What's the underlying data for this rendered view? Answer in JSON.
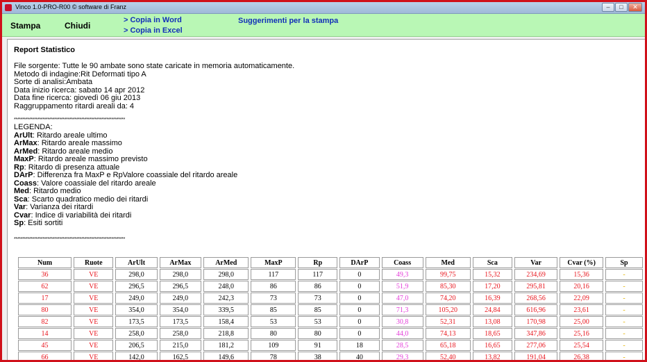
{
  "window": {
    "title": "Vinco 1.0-PRO-R00   © software di Franz"
  },
  "menu": {
    "stampa": "Stampa",
    "chiudi": "Chiudi",
    "copia_word": "> Copia in Word",
    "copia_excel": "> Copia in Excel",
    "suggerimenti": "Suggerimenti per la stampa"
  },
  "report": {
    "title": "Report Statistico",
    "info": [
      "File sorgente: Tutte le 90 ambate sono state caricate in memoria automaticamente.",
      "Metodo di indagine:Rit Deformati tipo A",
      "Sorte di analisi:Ambata",
      "Data inizio ricerca: sabato 14 apr 2012",
      "Data fine ricerca: giovedì 06 giu 2013",
      "Raggruppamento ritardi areali da: 4"
    ],
    "separator": "******************************************************************",
    "legend_title": "LEGENDA:",
    "legend": [
      {
        "key": "ArUlt",
        "desc": ": Ritardo areale ultimo"
      },
      {
        "key": "ArMax",
        "desc": ": Ritardo areale massimo"
      },
      {
        "key": "ArMed",
        "desc": ": Ritardo areale medio"
      },
      {
        "key": "MaxP",
        "desc": ": Ritardo areale massimo previsto"
      },
      {
        "key": "Rp",
        "desc": ": Ritardo di presenza attuale"
      },
      {
        "key": "DArP",
        "desc": ": Differenza fra MaxP e RpValore coassiale del ritardo areale"
      },
      {
        "key": "Coass",
        "desc": ": Valore coassiale del ritardo areale"
      },
      {
        "key": "Med",
        "desc": ": Ritardo medio"
      },
      {
        "key": "Sca",
        "desc": ": Scarto quadratico medio dei ritardi"
      },
      {
        "key": "Var",
        "desc": ": Varianza dei ritardi"
      },
      {
        "key": "Cvar",
        "desc": ": Indice di variabilità dei ritardi"
      },
      {
        "key": "Sp",
        "desc": ": Esiti sortiti"
      }
    ]
  },
  "table": {
    "headers": [
      "Num",
      "Ruote",
      "ArUlt",
      "ArMax",
      "ArMed",
      "MaxP",
      "Rp",
      "DArP",
      "Coass",
      "Med",
      "Sca",
      "Var",
      "Cvar (%)",
      "Sp"
    ],
    "rows": [
      [
        "36",
        "VE",
        "298,0",
        "298,0",
        "298,0",
        "117",
        "117",
        "0",
        "49,3",
        "99,75",
        "15,32",
        "234,69",
        "15,36",
        "-"
      ],
      [
        "62",
        "VE",
        "296,5",
        "296,5",
        "248,0",
        "86",
        "86",
        "0",
        "51,9",
        "85,30",
        "17,20",
        "295,81",
        "20,16",
        "-"
      ],
      [
        "17",
        "VE",
        "249,0",
        "249,0",
        "242,3",
        "73",
        "73",
        "0",
        "47,0",
        "74,20",
        "16,39",
        "268,56",
        "22,09",
        "-"
      ],
      [
        "80",
        "VE",
        "354,0",
        "354,0",
        "339,5",
        "85",
        "85",
        "0",
        "71,3",
        "105,20",
        "24,84",
        "616,96",
        "23,61",
        "-"
      ],
      [
        "82",
        "VE",
        "173,5",
        "173,5",
        "158,4",
        "53",
        "53",
        "0",
        "30,8",
        "52,31",
        "13,08",
        "170,98",
        "25,00",
        "-"
      ],
      [
        "14",
        "VE",
        "258,0",
        "258,0",
        "218,8",
        "80",
        "80",
        "0",
        "44,0",
        "74,13",
        "18,65",
        "347,86",
        "25,16",
        "-"
      ],
      [
        "45",
        "VE",
        "206,5",
        "215,0",
        "181,2",
        "109",
        "91",
        "18",
        "28,5",
        "65,18",
        "16,65",
        "277,06",
        "25,54",
        "-"
      ],
      [
        "66",
        "VE",
        "142,0",
        "162,5",
        "149,6",
        "78",
        "38",
        "40",
        "29,3",
        "52,40",
        "13,82",
        "191,04",
        "26,38",
        "-"
      ]
    ]
  }
}
